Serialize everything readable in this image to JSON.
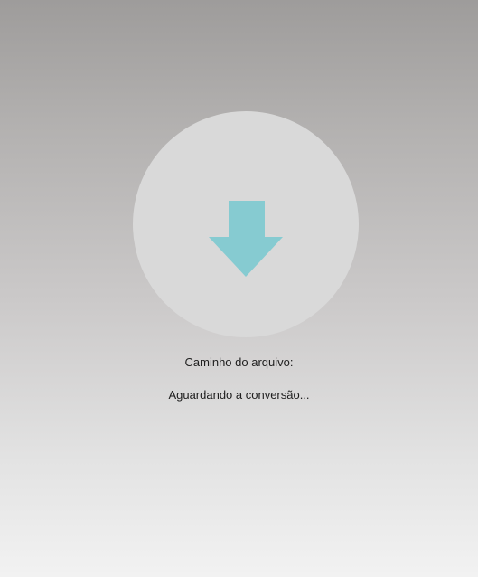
{
  "dropzone": {
    "icon": "download-arrow-icon",
    "icon_color": "#86cbd1",
    "circle_color": "#d9d9d9"
  },
  "file_path": {
    "label": "Caminho do arquivo:"
  },
  "status": {
    "text": "Aguardando a conversão..."
  }
}
